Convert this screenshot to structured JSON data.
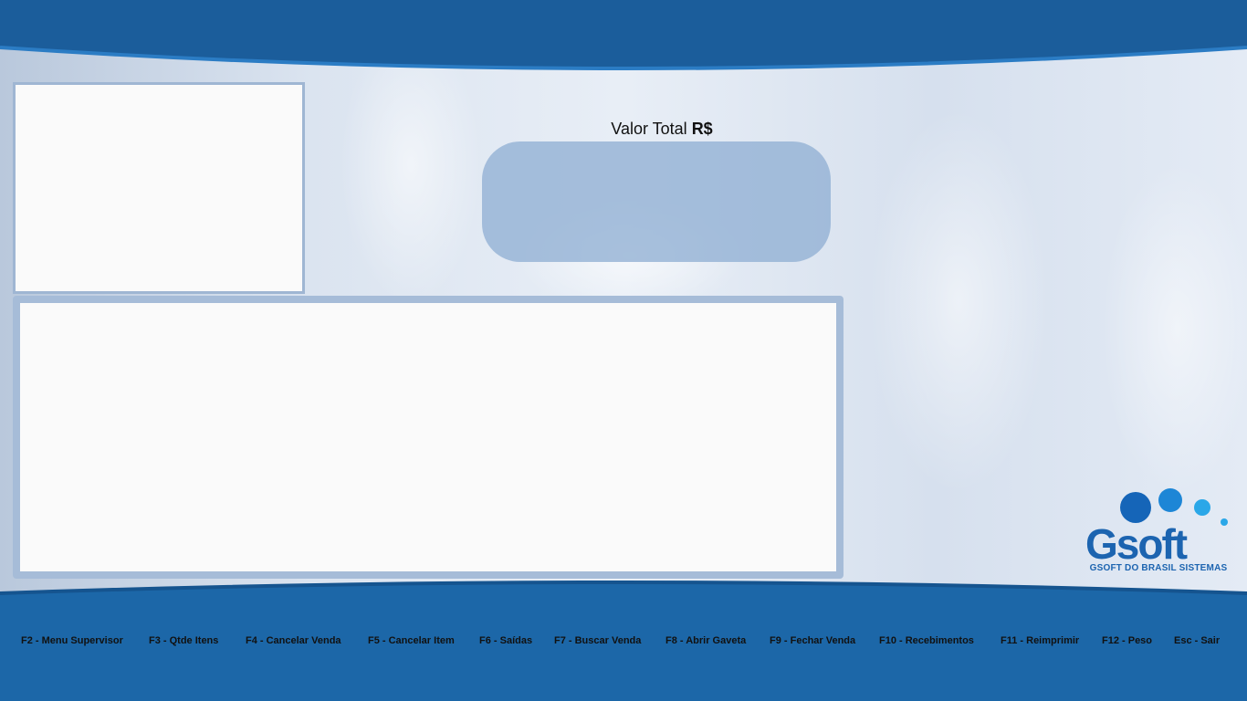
{
  "total": {
    "label_text": "Valor Total ",
    "currency": "R$",
    "value": ""
  },
  "brand": {
    "logo_text": "Gsoft",
    "tagline": "GSOFT DO BRASIL SISTEMAS",
    "color_primary": "#1b5d9b",
    "color_logo": "#1c64b0"
  },
  "shortcuts": [
    {
      "label": "F2 - Menu Supervisor"
    },
    {
      "label": "F3 - Qtde Itens"
    },
    {
      "label": "F4 - Cancelar Venda"
    },
    {
      "label": "F5 - Cancelar Item"
    },
    {
      "label": "F6 - Saídas"
    },
    {
      "label": "F7 - Buscar Venda"
    },
    {
      "label": "F8 - Abrir Gaveta"
    },
    {
      "label": "F9 - Fechar Venda"
    },
    {
      "label": "F10 - Recebimentos"
    },
    {
      "label": "F11 - Reimprimir"
    },
    {
      "label": "F12 - Peso"
    },
    {
      "label": "Esc - Sair"
    }
  ]
}
